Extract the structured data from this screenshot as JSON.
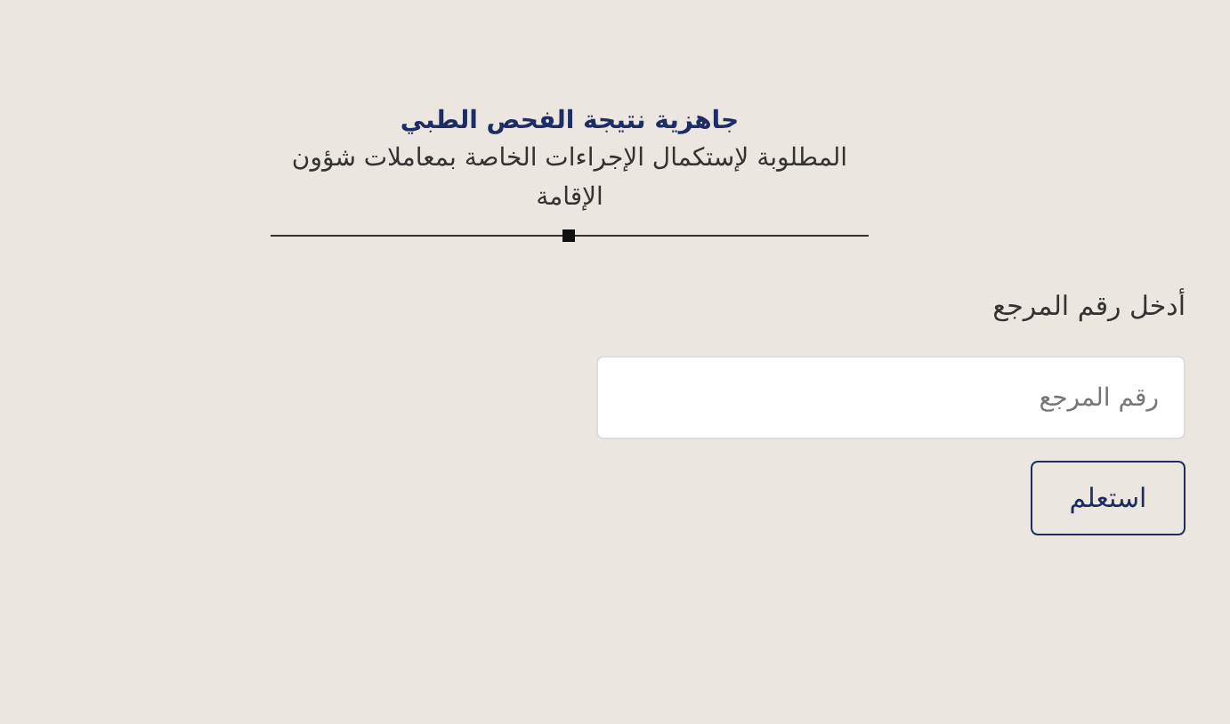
{
  "header": {
    "title": "جاهزية نتيجة الفحص الطبي",
    "subtitle": "المطلوبة لإستكمال الإجراءات الخاصة بمعاملات شؤون الإقامة"
  },
  "form": {
    "label": "أدخل رقم المرجع",
    "field": {
      "placeholder": "رقم المرجع"
    },
    "button": "استعلم"
  }
}
